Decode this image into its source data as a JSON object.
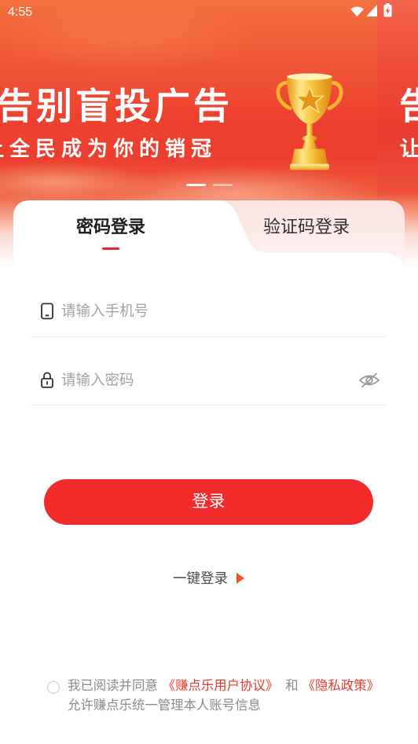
{
  "status_bar": {
    "time": "4:55",
    "icons": {
      "wifi": "wifi-icon",
      "signal": "cellular-signal-icon",
      "battery": "battery-charging-icon"
    }
  },
  "banner": {
    "slides": [
      {
        "headline": "告别盲投广告",
        "subline": "让全民成为你的销冠",
        "image": "trophy-illustration"
      },
      {
        "headline": "告",
        "subline": "让"
      }
    ],
    "indicator": {
      "count": 2,
      "active_index": 0
    }
  },
  "tabs": [
    {
      "label": "密码登录",
      "active": true
    },
    {
      "label": "验证码登录",
      "active": false
    }
  ],
  "form": {
    "phone": {
      "icon": "mobile-phone-icon",
      "placeholder": "请输入手机号",
      "value": ""
    },
    "password": {
      "icon": "lock-icon",
      "placeholder": "请输入密码",
      "value": "",
      "visibility_icon": "eye-off-icon"
    }
  },
  "login_button": {
    "label": "登录"
  },
  "quick_login": {
    "label": "一键登录",
    "icon": "play-arrow-icon"
  },
  "agreement": {
    "checked": false,
    "prefix": "我已阅读并同意",
    "user_agreement": "《赚点乐用户协议》",
    "conjunction": "和",
    "privacy_policy": "《隐私政策》",
    "note": "允许赚点乐统一管理本人账号信息"
  },
  "colors": {
    "accent": "#f22c2c",
    "link": "#e53b2e",
    "tab_indicator": "#e5262a",
    "banner_primary": "#ec3e2f",
    "inactive_tab_bg": "#fdeceb",
    "muted_text": "#8a8a8a"
  }
}
